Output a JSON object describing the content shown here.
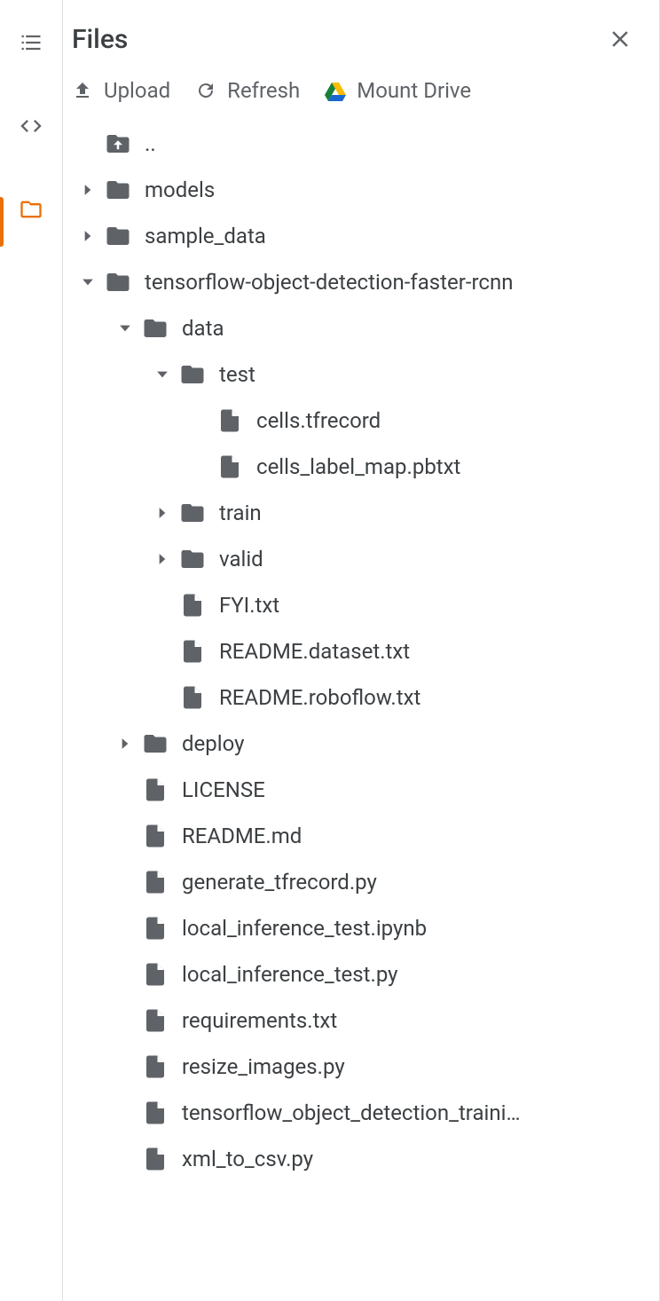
{
  "header": {
    "title": "Files"
  },
  "toolbar": {
    "upload": "Upload",
    "refresh": "Refresh",
    "mount_drive": "Mount Drive"
  },
  "tree": [
    {
      "level": 0,
      "kind": "up",
      "name": ".."
    },
    {
      "level": 0,
      "kind": "folder",
      "name": "models",
      "expanded": false
    },
    {
      "level": 0,
      "kind": "folder",
      "name": "sample_data",
      "expanded": false
    },
    {
      "level": 0,
      "kind": "folder",
      "name": "tensorflow-object-detection-faster-rcnn",
      "expanded": true
    },
    {
      "level": 1,
      "kind": "folder",
      "name": "data",
      "expanded": true
    },
    {
      "level": 2,
      "kind": "folder",
      "name": "test",
      "expanded": true
    },
    {
      "level": 3,
      "kind": "file",
      "name": "cells.tfrecord"
    },
    {
      "level": 3,
      "kind": "file",
      "name": "cells_label_map.pbtxt"
    },
    {
      "level": 2,
      "kind": "folder",
      "name": "train",
      "expanded": false
    },
    {
      "level": 2,
      "kind": "folder",
      "name": "valid",
      "expanded": false
    },
    {
      "level": 2,
      "kind": "file",
      "name": "FYI.txt"
    },
    {
      "level": 2,
      "kind": "file",
      "name": "README.dataset.txt"
    },
    {
      "level": 2,
      "kind": "file",
      "name": "README.roboflow.txt"
    },
    {
      "level": 1,
      "kind": "folder",
      "name": "deploy",
      "expanded": false
    },
    {
      "level": 1,
      "kind": "file",
      "name": "LICENSE"
    },
    {
      "level": 1,
      "kind": "file",
      "name": "README.md"
    },
    {
      "level": 1,
      "kind": "file",
      "name": "generate_tfrecord.py"
    },
    {
      "level": 1,
      "kind": "file",
      "name": "local_inference_test.ipynb"
    },
    {
      "level": 1,
      "kind": "file",
      "name": "local_inference_test.py"
    },
    {
      "level": 1,
      "kind": "file",
      "name": "requirements.txt"
    },
    {
      "level": 1,
      "kind": "file",
      "name": "resize_images.py"
    },
    {
      "level": 1,
      "kind": "file",
      "name": "tensorflow_object_detection_traini…"
    },
    {
      "level": 1,
      "kind": "file",
      "name": "xml_to_csv.py"
    }
  ]
}
